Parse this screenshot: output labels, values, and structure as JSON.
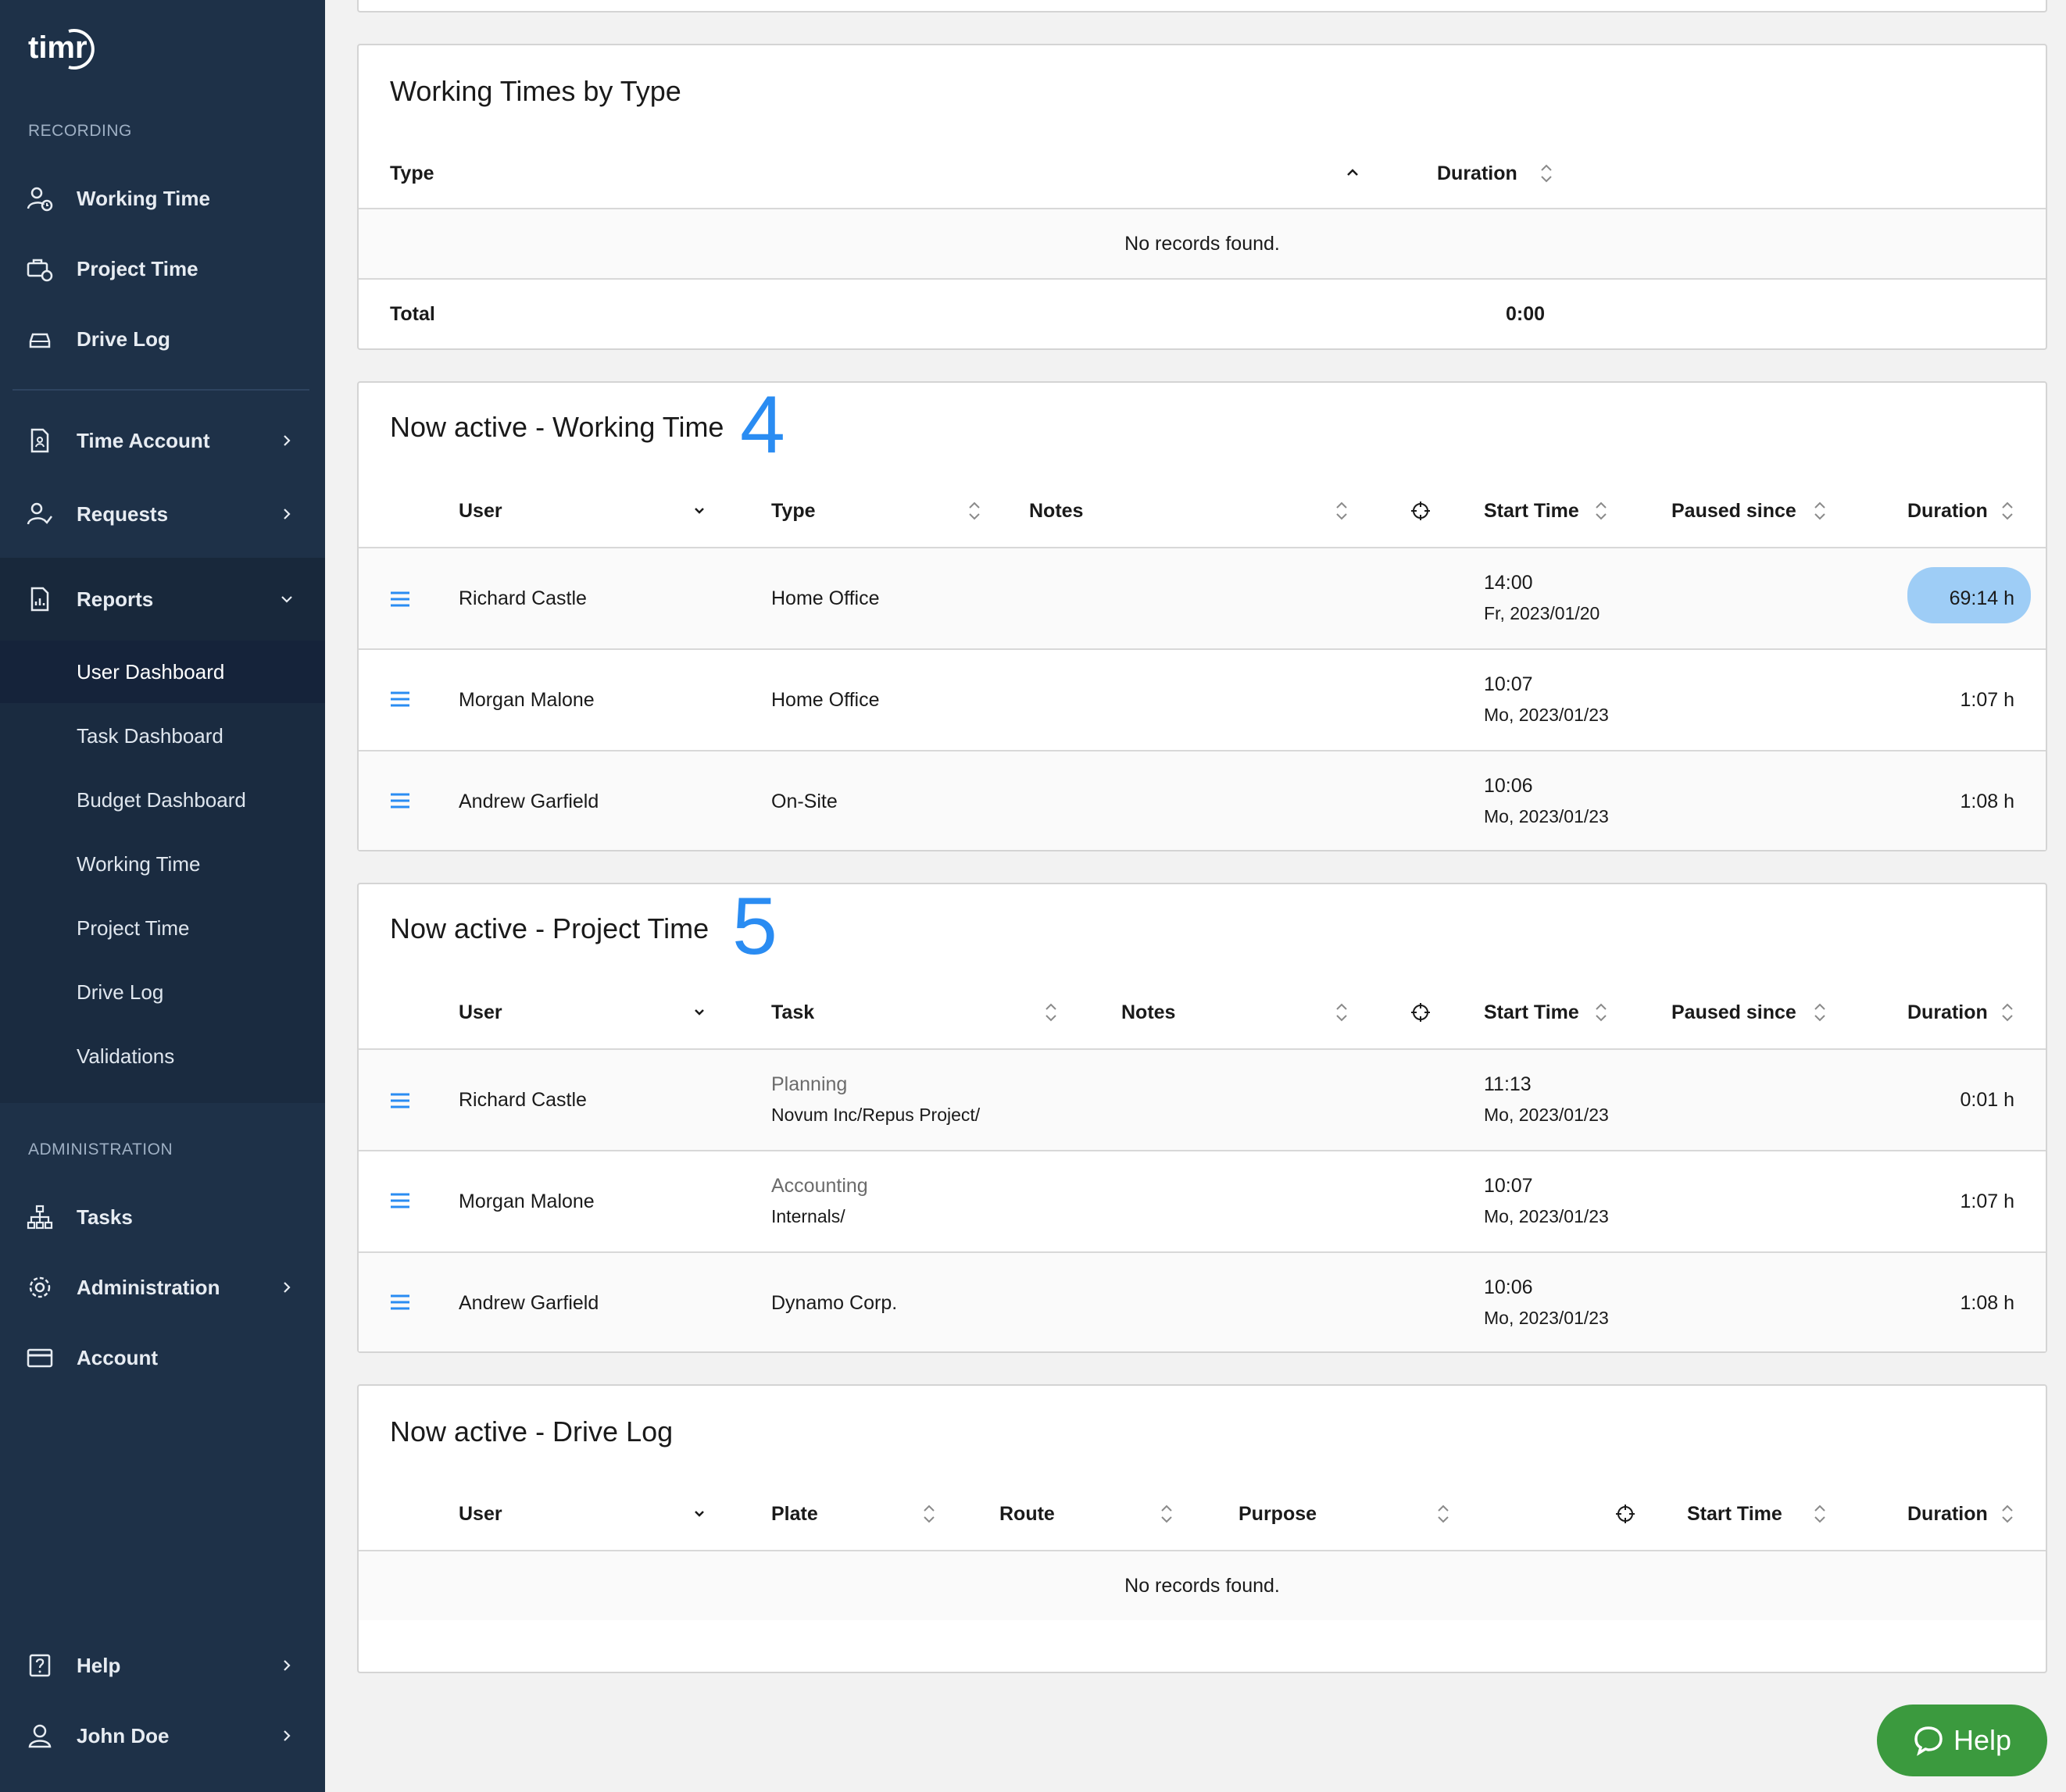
{
  "app": {
    "logo_text": "timr"
  },
  "sidebar": {
    "recording_label": "RECORDING",
    "recording_items": [
      {
        "label": "Working Time",
        "icon": "user-clock-icon"
      },
      {
        "label": "Project Time",
        "icon": "briefcase-clock-icon"
      },
      {
        "label": "Drive Log",
        "icon": "car-icon"
      }
    ],
    "nav_items": [
      {
        "label": "Time Account",
        "icon": "document-user-icon"
      },
      {
        "label": "Requests",
        "icon": "user-check-icon"
      },
      {
        "label": "Reports",
        "icon": "report-icon"
      }
    ],
    "report_subitems": [
      {
        "label": "User Dashboard"
      },
      {
        "label": "Task Dashboard"
      },
      {
        "label": "Budget Dashboard"
      },
      {
        "label": "Working Time"
      },
      {
        "label": "Project Time"
      },
      {
        "label": "Drive Log"
      },
      {
        "label": "Validations"
      }
    ],
    "admin_label": "ADMINISTRATION",
    "admin_items": [
      {
        "label": "Tasks",
        "icon": "hierarchy-icon"
      },
      {
        "label": "Administration",
        "icon": "gear-icon"
      },
      {
        "label": "Account",
        "icon": "credit-card-icon"
      }
    ],
    "bottom_items": [
      {
        "label": "Help",
        "icon": "help-icon"
      },
      {
        "label": "John Doe",
        "icon": "user-icon"
      }
    ]
  },
  "working_by_type": {
    "title": "Working Times by Type",
    "col_type": "Type",
    "col_duration": "Duration",
    "empty": "No records found.",
    "total_label": "Total",
    "total_value": "0:00"
  },
  "active_working": {
    "title": "Now active - Working Time",
    "annotation": "4",
    "cols": {
      "user": "User",
      "type": "Type",
      "notes": "Notes",
      "start": "Start Time",
      "paused": "Paused since",
      "duration": "Duration"
    },
    "rows": [
      {
        "user": "Richard Castle",
        "type": "Home Office",
        "start_time": "14:00",
        "start_date": "Fr, 2023/01/20",
        "duration": "69:14 h"
      },
      {
        "user": "Morgan Malone",
        "type": "Home Office",
        "start_time": "10:07",
        "start_date": "Mo, 2023/01/23",
        "duration": "1:07 h"
      },
      {
        "user": "Andrew Garfield",
        "type": "On-Site",
        "start_time": "10:06",
        "start_date": "Mo, 2023/01/23",
        "duration": "1:08 h"
      }
    ]
  },
  "active_project": {
    "title": "Now active - Project Time",
    "annotation": "5",
    "cols": {
      "user": "User",
      "task": "Task",
      "notes": "Notes",
      "start": "Start Time",
      "paused": "Paused since",
      "duration": "Duration"
    },
    "rows": [
      {
        "user": "Richard Castle",
        "task_name": "Planning",
        "task_path": "Novum Inc/Repus Project/",
        "start_time": "11:13",
        "start_date": "Mo, 2023/01/23",
        "duration": "0:01 h"
      },
      {
        "user": "Morgan Malone",
        "task_name": "Accounting",
        "task_path": "Internals/",
        "start_time": "10:07",
        "start_date": "Mo, 2023/01/23",
        "duration": "1:07 h"
      },
      {
        "user": "Andrew Garfield",
        "task_name": "",
        "task_path": "Dynamo Corp.",
        "start_time": "10:06",
        "start_date": "Mo, 2023/01/23",
        "duration": "1:08 h"
      }
    ]
  },
  "active_drive": {
    "title": "Now active - Drive Log",
    "cols": {
      "user": "User",
      "plate": "Plate",
      "route": "Route",
      "purpose": "Purpose",
      "start": "Start Time",
      "duration": "Duration"
    },
    "empty": "No records found."
  },
  "help_button": {
    "label": "Help",
    "icon": "chat-bubble-icon",
    "color": "#3b9a3e"
  },
  "colors": {
    "sidebar_bg": "#1e3148",
    "accent": "#2a8cf2",
    "highlight": "#9ecdf6"
  }
}
